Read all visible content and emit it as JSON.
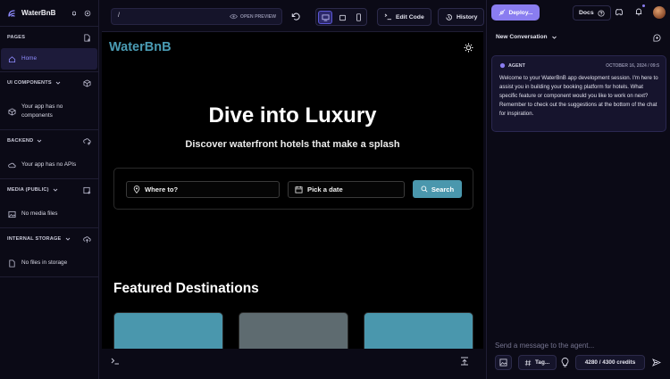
{
  "sidebar": {
    "brand": "WaterBnB",
    "sections": {
      "pages": {
        "title": "PAGES",
        "items": [
          {
            "label": "Home"
          }
        ]
      },
      "ui_components": {
        "title": "UI COMPONENTS",
        "empty": "Your app has no components"
      },
      "backend": {
        "title": "BACKEND",
        "empty": "Your app has no APIs"
      },
      "media": {
        "title": "MEDIA (PUBLIC)",
        "empty": "No media files"
      },
      "storage": {
        "title": "INTERNAL STORAGE",
        "empty": "No files in storage"
      }
    }
  },
  "toolbar": {
    "url": "/",
    "open_preview": "OPEN PREVIEW",
    "edit_code": "Edit Code",
    "history": "History"
  },
  "preview": {
    "logo": "WaterBnB",
    "hero_title": "Dive into Luxury",
    "hero_subtitle": "Discover waterfront hotels that make a splash",
    "where_placeholder": "Where to?",
    "date_placeholder": "Pick a date",
    "search_label": "Search",
    "featured_title": "Featured Destinations",
    "cards": [
      {
        "color": "#4a97ad"
      },
      {
        "color": "#5e6b70"
      },
      {
        "color": "#4a97ad"
      }
    ]
  },
  "right_panel": {
    "deploy_label": "Deploy...",
    "docs_label": "Docs",
    "conversation_label": "New Conversation",
    "message": {
      "role": "AGENT",
      "timestamp": "OCTOBER 16, 2024 / 09:5",
      "text": "Welcome to your WaterBnB app development session. I'm here to assist you in building your booking platform for hotels. What specific feature or component would you like to work on next? Remember to check out the suggestions at the bottom of the chat for inspiration."
    },
    "input_placeholder": "Send a message to the agent...",
    "tag_label": "Tag...",
    "credits": "4280 / 4300 credits"
  },
  "colors": {
    "accent": "#8a7df0",
    "brand_teal": "#4a9bb3",
    "active_item": "#8f8cff"
  }
}
